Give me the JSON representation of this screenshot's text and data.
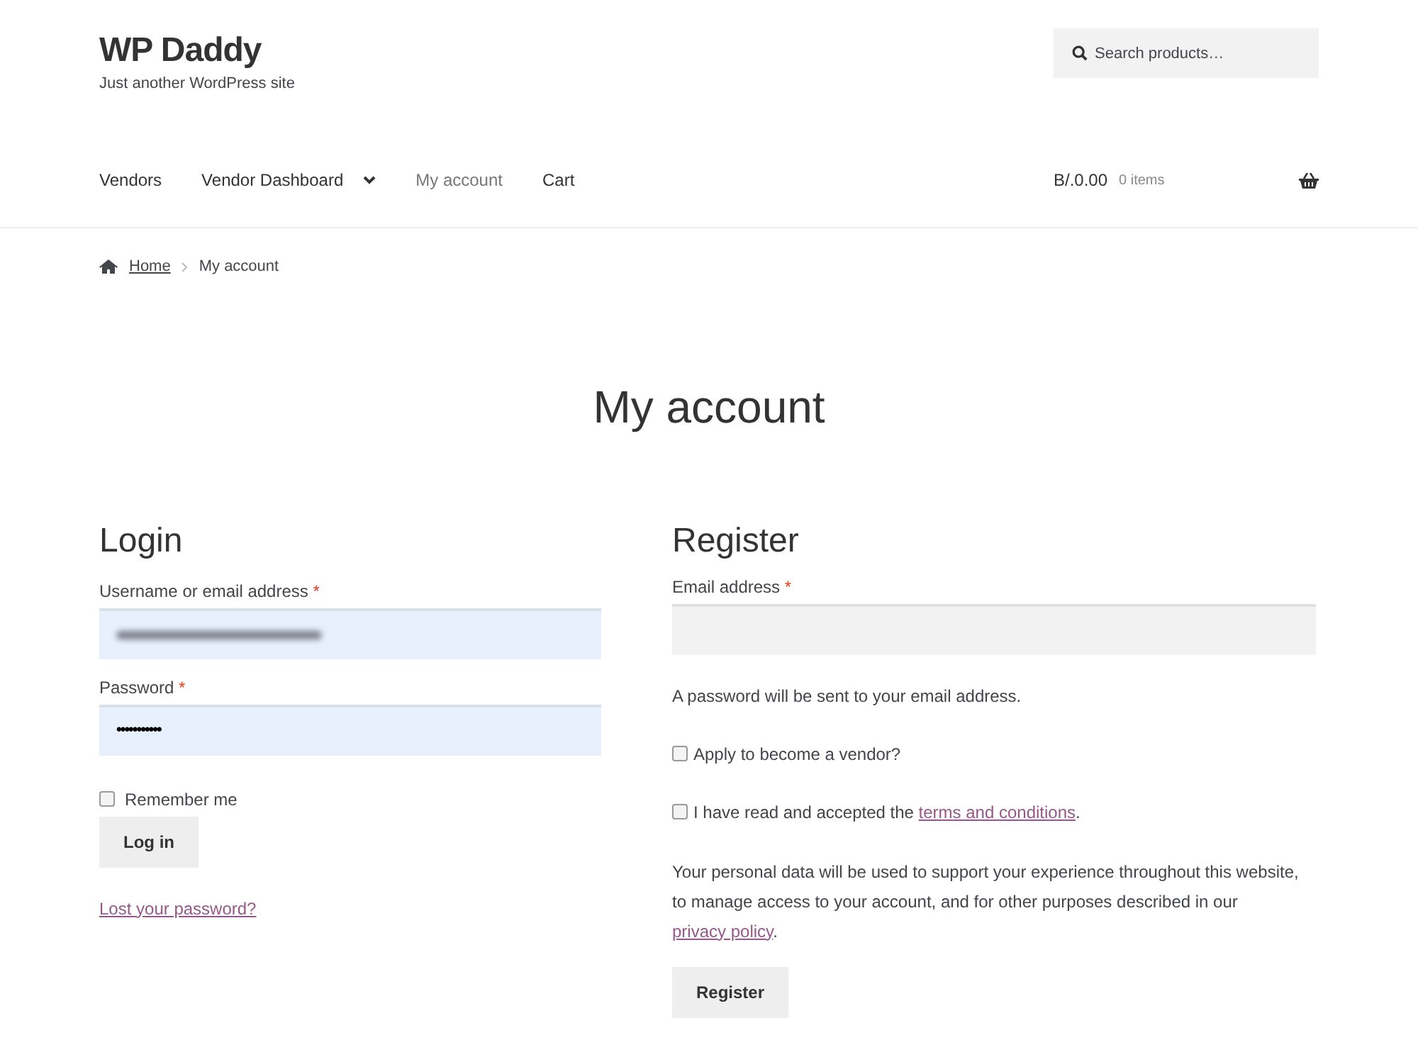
{
  "site": {
    "title": "WP Daddy",
    "tagline": "Just another WordPress site"
  },
  "search": {
    "placeholder": "Search products…"
  },
  "nav": [
    {
      "label": "Vendors",
      "selected": false,
      "has_submenu": false
    },
    {
      "label": "Vendor Dashboard",
      "selected": false,
      "has_submenu": true
    },
    {
      "label": "My account",
      "selected": true,
      "has_submenu": false
    },
    {
      "label": "Cart",
      "selected": false,
      "has_submenu": false
    }
  ],
  "cart": {
    "total": "B/.0.00",
    "count": "0 items"
  },
  "breadcrumb": [
    {
      "label": "Home",
      "link": true
    },
    {
      "label": "My account",
      "link": false
    }
  ],
  "page_title": "My account",
  "login": {
    "heading": "Login",
    "fields": [
      {
        "label": "Username or email address",
        "required": "*",
        "value_blurred": true
      },
      {
        "label": "Password",
        "required": "*",
        "value": "•••••••••••"
      }
    ],
    "remember": {
      "label": "Remember me",
      "checked": false
    },
    "button": "Log in",
    "lost_link": "Lost your password?"
  },
  "register": {
    "heading": "Register",
    "field": {
      "label": "Email address",
      "required": "*"
    },
    "note": "A password will be sent to your email address.",
    "checkboxes": [
      {
        "text": "Apply to become a vendor?",
        "checked": false
      },
      {
        "text": "I have read and accepted the ",
        "link": "terms and conditions",
        "after": ".",
        "checked": false
      }
    ],
    "privacy": {
      "text": "Your personal data will be used to support your experience throughout this website, to manage access to your account, and for other purposes described in our ",
      "link": "privacy policy",
      "after": "."
    },
    "button": "Register"
  }
}
